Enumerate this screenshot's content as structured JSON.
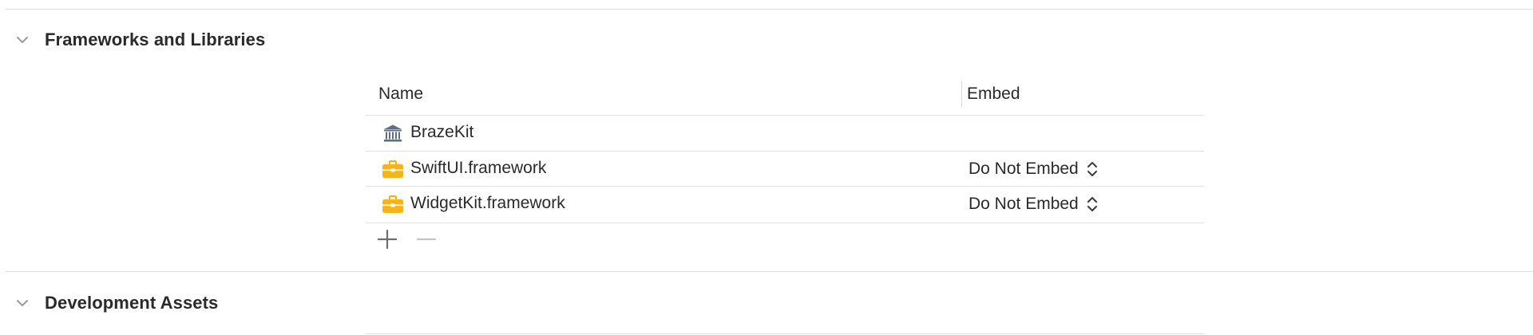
{
  "frameworks_section": {
    "title": "Frameworks and Libraries",
    "toggle_icon": "chevron-down-icon",
    "table": {
      "columns": [
        "Name",
        "Embed"
      ],
      "rows": [
        {
          "name": "BrazeKit",
          "icon": "library-icon",
          "embed": ""
        },
        {
          "name": "SwiftUI.framework",
          "icon": "toolbox-icon",
          "embed": "Do Not Embed"
        },
        {
          "name": "WidgetKit.framework",
          "icon": "toolbox-icon",
          "embed": "Do Not Embed"
        }
      ],
      "add_icon": "plus-icon",
      "remove_icon": "minus-icon"
    }
  },
  "development_section": {
    "title": "Development Assets",
    "toggle_icon": "chevron-down-icon"
  },
  "colors": {
    "toolbox_yellow": "#f5b41a",
    "library_slate": "#5a6f86"
  }
}
